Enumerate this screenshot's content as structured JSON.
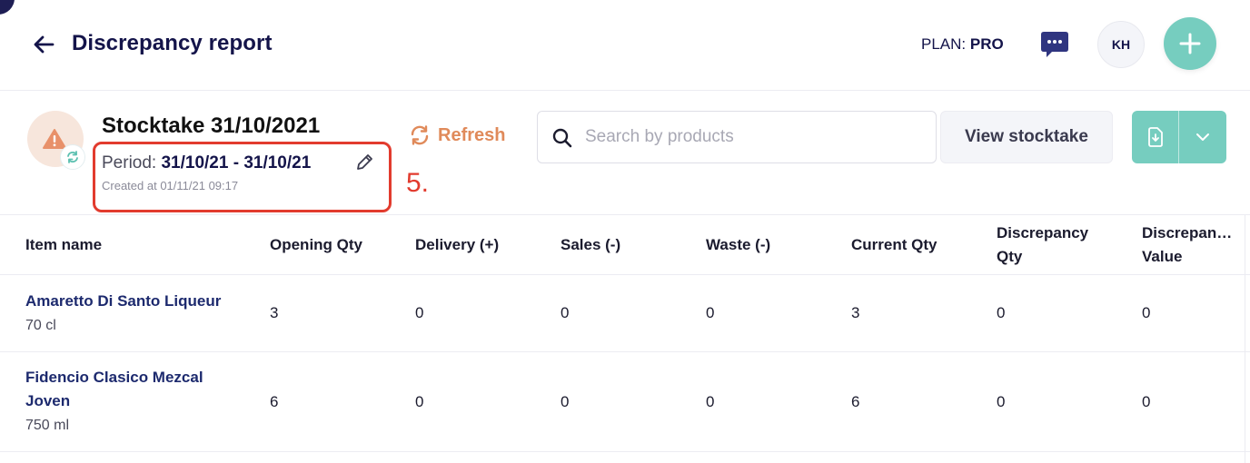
{
  "header": {
    "title": "Discrepancy report",
    "plan_label": "PLAN:",
    "plan_value": "PRO",
    "avatar_initials": "KH"
  },
  "stocktake": {
    "title": "Stocktake 31/10/2021",
    "period_label": "Period:",
    "period_value": "31/10/21 - 31/10/21",
    "created": "Created at 01/11/21 09:17"
  },
  "annotation": {
    "step": "5."
  },
  "toolbar": {
    "refresh_label": "Refresh",
    "search_placeholder": "Search by products",
    "view_label": "View stocktake"
  },
  "table": {
    "columns": [
      "Item name",
      "Opening Qty",
      "Delivery (+)",
      "Sales (-)",
      "Waste (-)",
      "Current Qty",
      "Discrepancy\nQty",
      "Discrepan…\nValue"
    ],
    "rows": [
      {
        "name": "Amaretto Di Santo Liqueur",
        "size": "70 cl",
        "values": [
          "3",
          "0",
          "0",
          "0",
          "3",
          "0",
          "0"
        ]
      },
      {
        "name": "Fidencio Clasico Mezcal Joven",
        "size": "750 ml",
        "values": [
          "6",
          "0",
          "0",
          "0",
          "6",
          "0",
          "0"
        ]
      }
    ]
  },
  "colors": {
    "accent_teal": "#76cdbf",
    "navy": "#14144a",
    "refresh_orange": "#e08a5a",
    "annotation_red": "#e23b2e",
    "warning_bg": "#f7e6dc"
  }
}
